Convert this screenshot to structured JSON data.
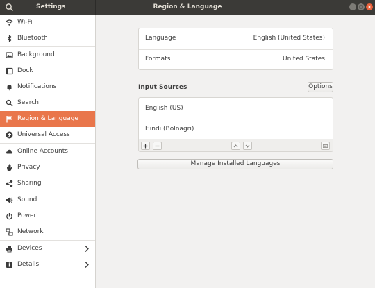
{
  "header": {
    "app_title": "Settings",
    "page_title": "Region & Language"
  },
  "sidebar": {
    "items": [
      {
        "label": "Wi-Fi",
        "icon": "wifi-icon"
      },
      {
        "label": "Bluetooth",
        "icon": "bluetooth-icon"
      },
      {
        "label": "Background",
        "icon": "background-icon"
      },
      {
        "label": "Dock",
        "icon": "dock-icon"
      },
      {
        "label": "Notifications",
        "icon": "bell-icon"
      },
      {
        "label": "Search",
        "icon": "search-icon"
      },
      {
        "label": "Region & Language",
        "icon": "flag-icon",
        "active": true
      },
      {
        "label": "Universal Access",
        "icon": "accessibility-icon"
      },
      {
        "label": "Online Accounts",
        "icon": "cloud-icon"
      },
      {
        "label": "Privacy",
        "icon": "hand-icon"
      },
      {
        "label": "Sharing",
        "icon": "share-icon"
      },
      {
        "label": "Sound",
        "icon": "speaker-icon"
      },
      {
        "label": "Power",
        "icon": "power-icon"
      },
      {
        "label": "Network",
        "icon": "network-icon"
      },
      {
        "label": "Devices",
        "icon": "printer-icon",
        "chevron": true
      },
      {
        "label": "Details",
        "icon": "info-icon",
        "chevron": true
      }
    ]
  },
  "main": {
    "language": {
      "label": "Language",
      "value": "English (United States)"
    },
    "formats": {
      "label": "Formats",
      "value": "United States"
    },
    "input_sources_title": "Input Sources",
    "options_label": "Options",
    "input_sources": [
      "English (US)",
      "Hindi (Bolnagri)"
    ],
    "manage_label": "Manage Installed Languages"
  },
  "colors": {
    "accent": "#e9764b",
    "header_bg": "#3b3a37",
    "close_button": "#e9603a"
  }
}
